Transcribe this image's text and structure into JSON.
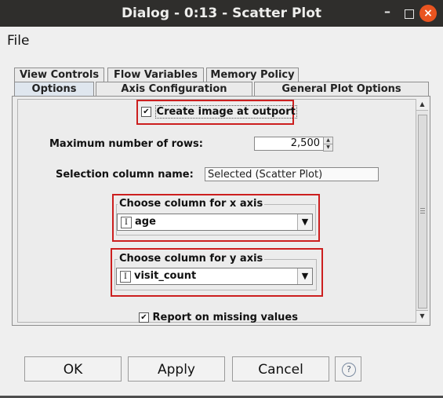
{
  "window": {
    "title": "Dialog - 0:13 - Scatter Plot",
    "minimize_icon": "minimize-icon",
    "maximize_icon": "maximize-icon",
    "close_glyph": "×",
    "close_color": "#e95420"
  },
  "menu": {
    "file": "File"
  },
  "tabs": {
    "row1": [
      "View Controls",
      "Flow Variables",
      "Memory Policy"
    ],
    "row2": [
      "Options",
      "Axis Configuration",
      "General Plot Options"
    ],
    "active": "Options"
  },
  "options": {
    "create_image_label": "Create image at outport",
    "create_image_checked": true,
    "max_rows_label": "Maximum number of rows:",
    "max_rows_value": "2,500",
    "selection_column_label": "Selection column name:",
    "selection_column_value": "Selected (Scatter Plot)",
    "x_axis": {
      "title": "Choose column for x axis",
      "type_glyph": "I",
      "value": "age"
    },
    "y_axis": {
      "title": "Choose column for y axis",
      "type_glyph": "I",
      "value": "visit_count"
    },
    "report_missing_label": "Report on missing values",
    "report_missing_checked": true,
    "check_glyph": "✔",
    "highlight_color": "#cc1f1f"
  },
  "buttons": {
    "ok": "OK",
    "apply": "Apply",
    "cancel": "Cancel",
    "help_glyph": "?"
  }
}
